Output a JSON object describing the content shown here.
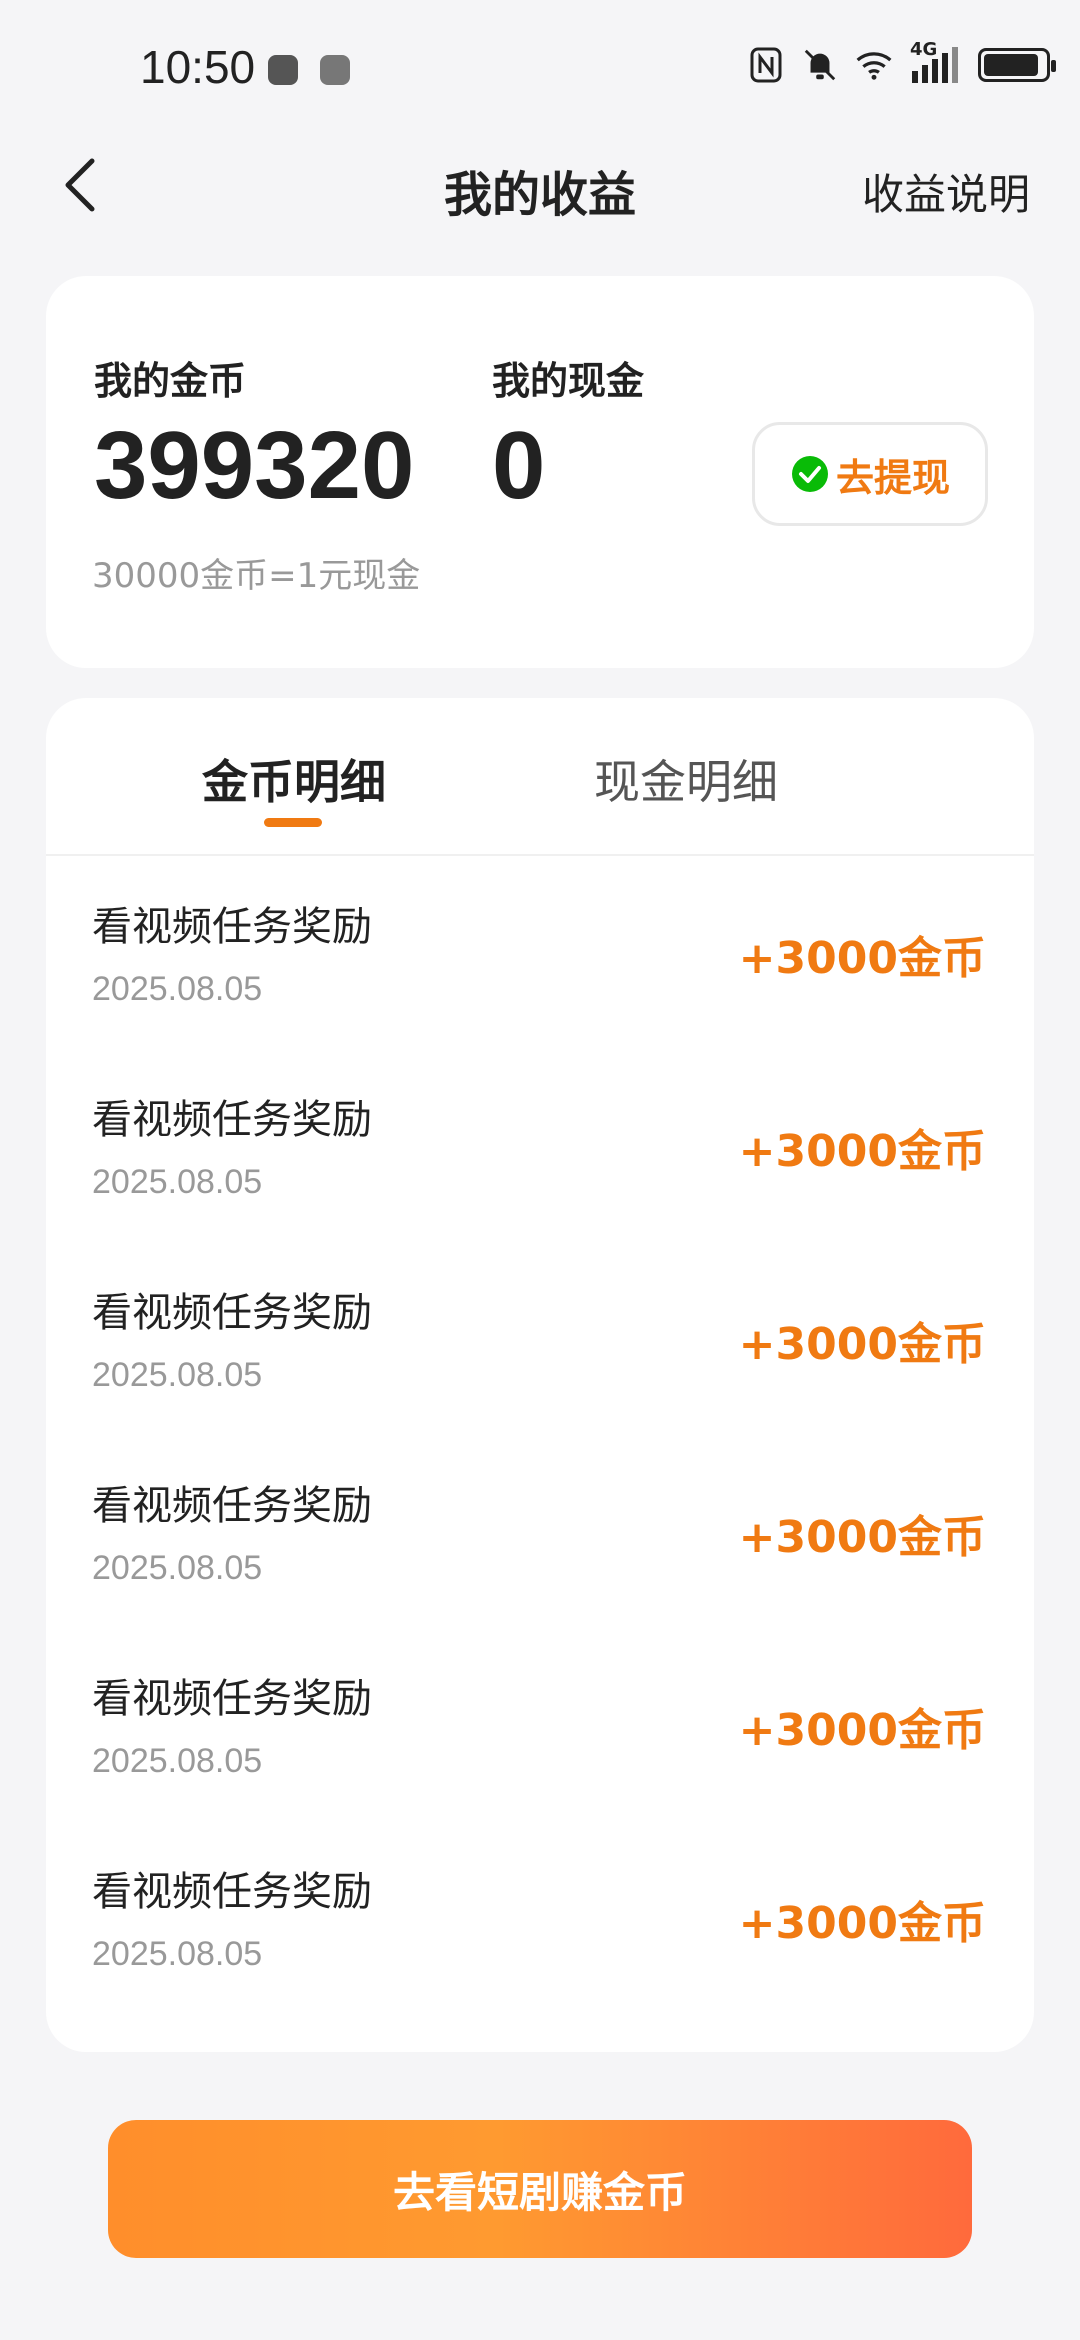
{
  "status_bar": {
    "time": "10:50",
    "icons": [
      "nfc-icon",
      "mute-icon",
      "wifi-icon",
      "signal-4g-icon",
      "battery-icon"
    ],
    "signal_label": "4G",
    "battery_level": 0.9
  },
  "header": {
    "title": "我的收益",
    "right_link": "收益说明"
  },
  "balance": {
    "coins_label": "我的金币",
    "coins_value": "399320",
    "cash_label": "我的现金",
    "cash_value": "0",
    "rate_text": "30000金币=1元现金",
    "withdraw_label": "去提现",
    "withdraw_icon": "wechat-icon"
  },
  "tabs": [
    {
      "label": "金币明细",
      "active": true
    },
    {
      "label": "现金明细",
      "active": false
    }
  ],
  "records": [
    {
      "title": "看视频任务奖励",
      "date": "2025.08.05",
      "amount": "+3000金币"
    },
    {
      "title": "看视频任务奖励",
      "date": "2025.08.05",
      "amount": "+3000金币"
    },
    {
      "title": "看视频任务奖励",
      "date": "2025.08.05",
      "amount": "+3000金币"
    },
    {
      "title": "看视频任务奖励",
      "date": "2025.08.05",
      "amount": "+3000金币"
    },
    {
      "title": "看视频任务奖励",
      "date": "2025.08.05",
      "amount": "+3000金币"
    },
    {
      "title": "看视频任务奖励",
      "date": "2025.08.05",
      "amount": "+3000金币"
    }
  ],
  "cta": {
    "label": "去看短剧赚金币"
  },
  "colors": {
    "accent": "#f07a12",
    "background": "#f5f5f7",
    "wechat_green": "#09bb07"
  }
}
